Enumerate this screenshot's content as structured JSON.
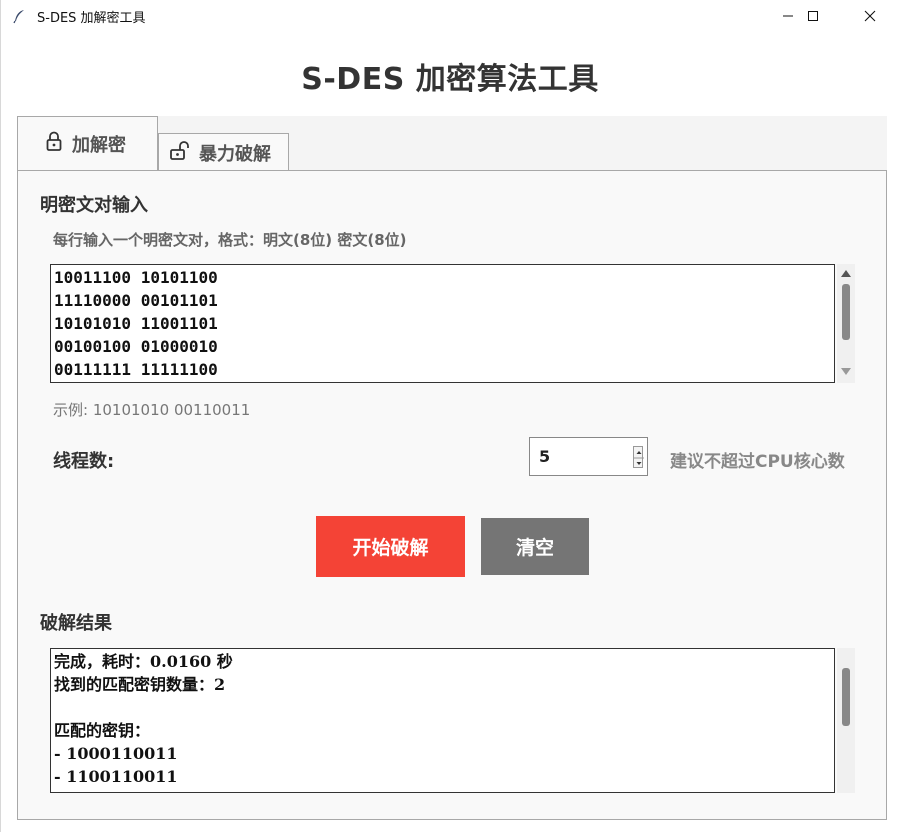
{
  "window": {
    "title": "S-DES 加解密工具"
  },
  "app": {
    "title": "S-DES 加密算法工具"
  },
  "tabs": [
    {
      "label": "加解密",
      "icon": "lock-icon",
      "selected": false
    },
    {
      "label": "暴力破解",
      "icon": "unlock-icon",
      "selected": true
    }
  ],
  "input_section": {
    "label": "明密文对输入",
    "hint": "每行输入一个明密文对，格式：明文(8位) 密文(8位)",
    "pairs": "10011100 10101100\n11110000 00101101\n10101010 11001101\n00100100 01000010\n00111111 11111100",
    "example": "示例: 10101010 00110011"
  },
  "threads": {
    "label": "线程数:",
    "value": "5",
    "suggestion": "建议不超过CPU核心数"
  },
  "buttons": {
    "start": "开始破解",
    "clear": "清空"
  },
  "result_section": {
    "label": "破解结果",
    "text": "完成，耗时：0.0160 秒\n找到的匹配密钥数量：2\n\n匹配的密钥：\n- 1000110011\n- 1100110011"
  },
  "colors": {
    "start_button": "#f44336",
    "clear_button": "#757575"
  }
}
